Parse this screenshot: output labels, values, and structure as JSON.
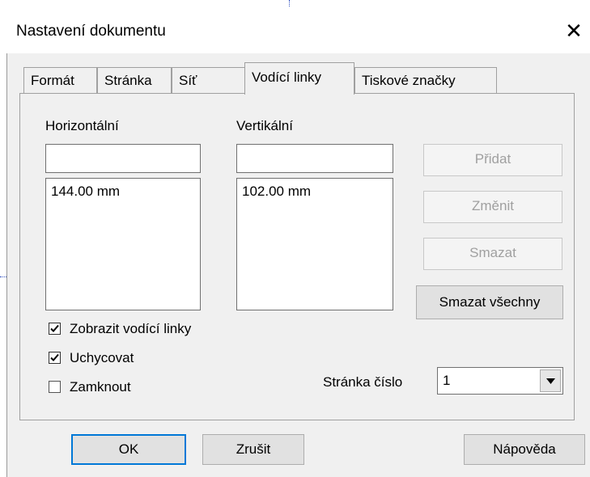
{
  "window": {
    "title": "Nastavení dokumentu",
    "close_glyph": "✕"
  },
  "tabs": [
    {
      "label": "Formát"
    },
    {
      "label": "Stránka"
    },
    {
      "label": "Síť"
    },
    {
      "label": "Vodící linky",
      "active": true
    },
    {
      "label": "Tiskové značky"
    }
  ],
  "guides": {
    "horizontal": {
      "label": "Horizontální",
      "input_value": "",
      "items": [
        "144.00 mm"
      ]
    },
    "vertical": {
      "label": "Vertikální",
      "input_value": "",
      "items": [
        "102.00 mm"
      ]
    }
  },
  "buttons": {
    "add": "Přidat",
    "change": "Změnit",
    "delete": "Smazat",
    "delete_all": "Smazat všechny"
  },
  "checkboxes": [
    {
      "label": "Zobrazit vodící linky",
      "checked": true
    },
    {
      "label": "Uchycovat",
      "checked": true
    },
    {
      "label": "Zamknout",
      "checked": false
    }
  ],
  "page_number": {
    "label": "Stránka číslo",
    "value": "1"
  },
  "footer": {
    "ok": "OK",
    "cancel": "Zrušit",
    "help": "Nápověda"
  }
}
